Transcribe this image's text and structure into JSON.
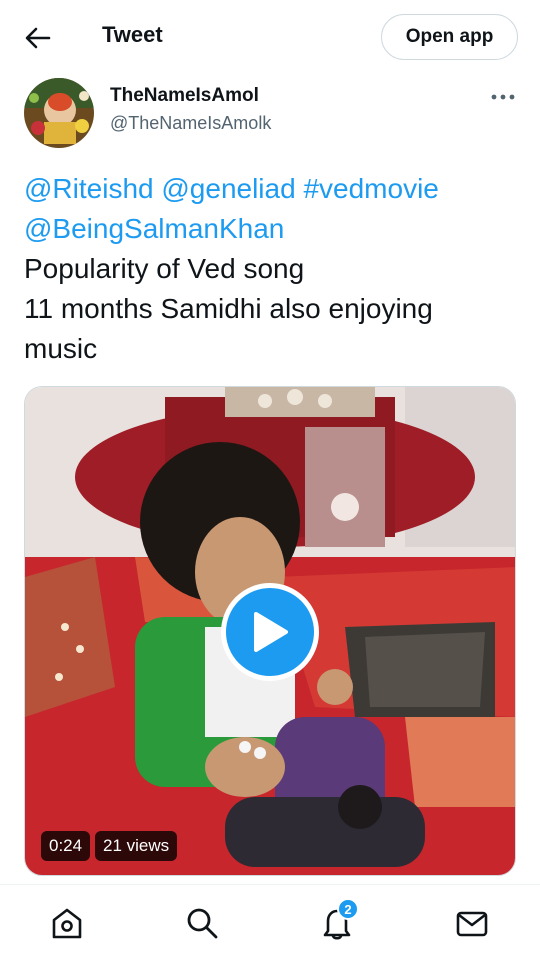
{
  "header": {
    "title": "Tweet",
    "back_icon": "arrow-left-icon",
    "open_app_label": "Open app"
  },
  "author": {
    "name": "TheNameIsAmol",
    "handle": "@TheNameIsAmolk",
    "more_icon": "more-dots-icon"
  },
  "tweet": {
    "line1": [
      {
        "text": "@Riteishd",
        "type": "mention"
      },
      {
        "text": " ",
        "type": "space"
      },
      {
        "text": "@geneliad",
        "type": "mention"
      },
      {
        "text": " ",
        "type": "space"
      },
      {
        "text": "#vedmovie",
        "type": "hashtag"
      }
    ],
    "line2_mention": "@BeingSalmanKhan",
    "line3": "Popularity of Ved song",
    "line4": "11 months  Samidhi also enjoying",
    "line5": "music"
  },
  "media": {
    "type": "video",
    "duration": "0:24",
    "views": "21 views",
    "play_icon": "play-icon"
  },
  "bottom_nav": {
    "items": [
      "home-icon",
      "search-icon",
      "notifications-icon",
      "messages-icon"
    ],
    "notification_count": "2"
  },
  "colors": {
    "accent": "#1d9bf0",
    "text": "#0f1419",
    "secondary_text": "#536471"
  }
}
